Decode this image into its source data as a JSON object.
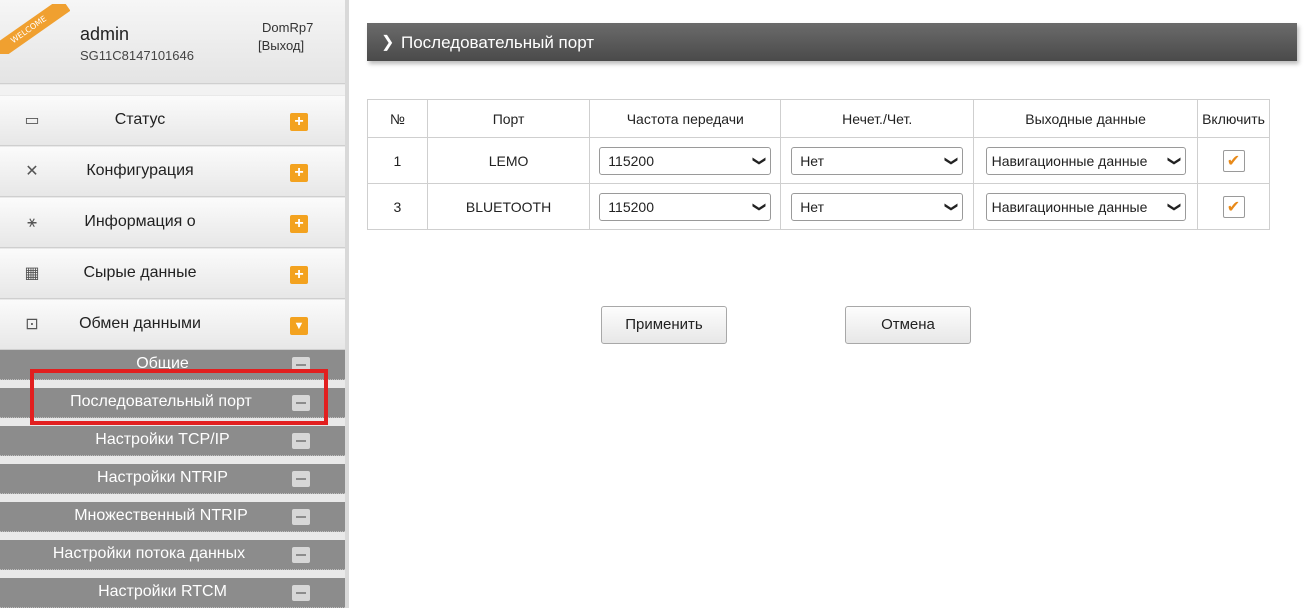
{
  "user": {
    "welcome": "WELCOME",
    "name": "admin",
    "serial": "SG11C8147101646",
    "device": "DomRp7",
    "logout": "[Выход]"
  },
  "menu": [
    {
      "label": "Статус",
      "icon": "monitor-icon",
      "expanded": false
    },
    {
      "label": "Конфигурация",
      "icon": "tools-icon",
      "expanded": false
    },
    {
      "label": "Информация о",
      "icon": "satellite-icon",
      "expanded": false
    },
    {
      "label": "Сырые данные",
      "icon": "calendar-icon",
      "expanded": false
    },
    {
      "label": "Обмен данными",
      "icon": "network-icon",
      "expanded": true
    }
  ],
  "submenu": [
    {
      "label": "Общие"
    },
    {
      "label": "Последовательный порт"
    },
    {
      "label": "Настройки TCP/IP"
    },
    {
      "label": "Настройки NTRIP"
    },
    {
      "label": "Множественный NTRIP"
    },
    {
      "label": "Настройки потока данных"
    },
    {
      "label": "Настройки RTCM"
    }
  ],
  "page": {
    "title": "Последовательный порт"
  },
  "table": {
    "headers": [
      "№",
      "Порт",
      "Частота передачи",
      "Нечет./Чет.",
      "Выходные данные",
      "Включить"
    ],
    "rows": [
      {
        "no": "1",
        "port": "LEMO",
        "baud": "115200",
        "parity": "Нет",
        "output": "Навигационные данные",
        "enabled": true
      },
      {
        "no": "3",
        "port": "BLUETOOTH",
        "baud": "115200",
        "parity": "Нет",
        "output": "Навигационные данные",
        "enabled": true
      }
    ]
  },
  "buttons": {
    "apply": "Применить",
    "cancel": "Отмена"
  },
  "colors": {
    "accent": "#f3a21f",
    "highlight": "#e21f1f",
    "title_bar": "#4a4a4a",
    "submenu_bg": "#8c8c8c"
  }
}
